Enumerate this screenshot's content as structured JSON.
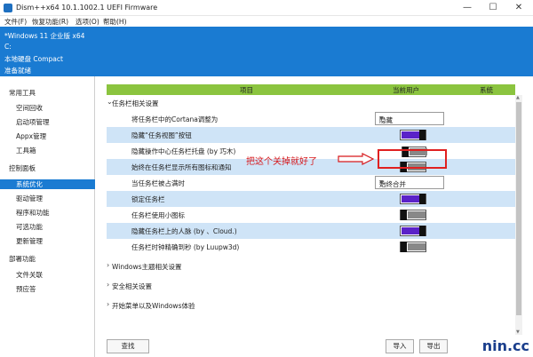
{
  "window": {
    "title": "Dism++x64 10.1.1002.1 UEFI Firmware",
    "minimize": "—",
    "maximize": "☐",
    "close": "✕"
  },
  "menu": [
    "文件(F)",
    "恢复功能(R)",
    "选项(O)",
    "帮助(H)"
  ],
  "info": {
    "line1": "*Windows 11 企业版 x64",
    "line2": "C:",
    "line3": "本地硬盘 Compact",
    "line4": "准备就绪"
  },
  "sidebar": {
    "section1": "常用工具",
    "tools": [
      "空间回收",
      "启动项管理",
      "Appx管理",
      "工具箱"
    ],
    "section2": "控制面板",
    "panel": [
      "系统优化",
      "驱动管理",
      "程序和功能",
      "可选功能",
      "更新管理"
    ],
    "section3": "部署功能",
    "deploy": [
      "文件关联",
      "预应答"
    ]
  },
  "table": {
    "col_item": "项目",
    "col_user": "当前用户",
    "col_system": "系统",
    "group_taskbar": "任务栏相关设置",
    "r1": "将任务栏中的Cortana调整为",
    "r1_value": "隐藏",
    "r2": "隐藏“任务视图”按钮",
    "r3": "隐藏操作中心任务栏托盘 (by 巧木)",
    "r4": "始终在任务栏显示所有图标和通知",
    "r5": "当任务栏被占满时",
    "r5_value": "始终合并",
    "r6": "锁定任务栏",
    "r7": "任务栏使用小图标",
    "r8": "隐藏任务栏上的人脉 (by 、Cloud.)",
    "r9": "任务栏时钟精确到秒 (by Luupw3d)",
    "group_theme": "Windows主题相关设置",
    "group_security": "安全相关设置",
    "group_start": "开始菜单以及Windows体验"
  },
  "annotation": "把这个关掉就好了",
  "buttons": {
    "find": "查找",
    "b1": "导入",
    "b2": "导出"
  },
  "watermark": "nin.cc",
  "colors": {
    "accent": "#1a7bd2",
    "header": "#8bc43f",
    "toggle_on": "#5a22c8",
    "annotation": "#d7191c"
  }
}
